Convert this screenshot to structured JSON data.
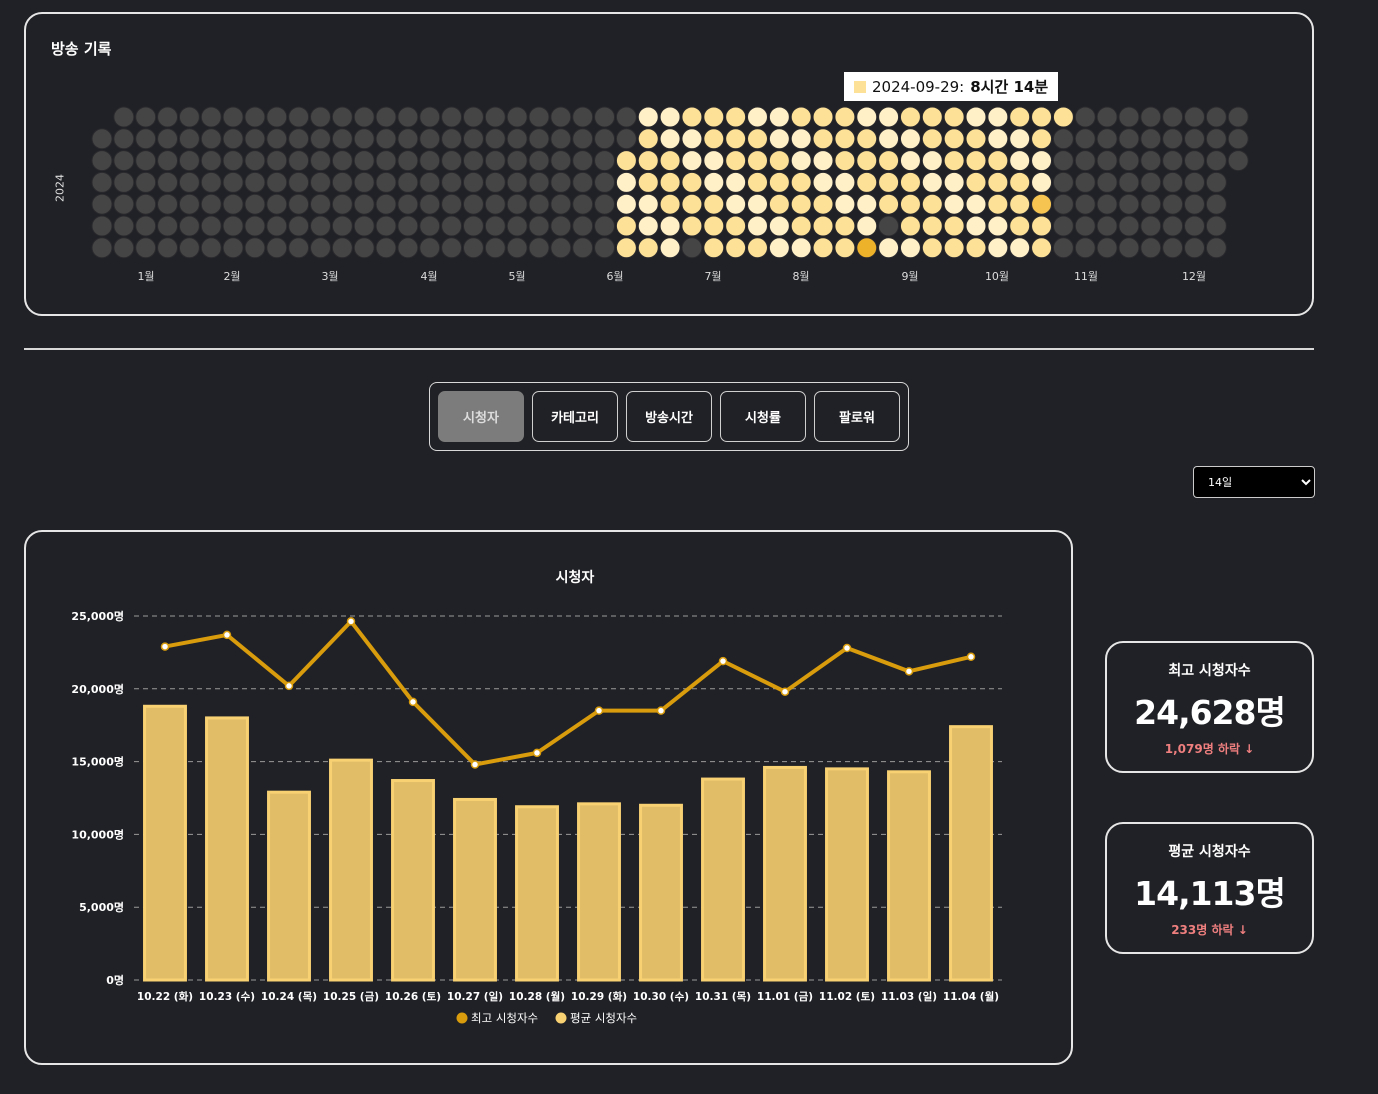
{
  "history": {
    "title": "방송 기록",
    "year": "2024",
    "months": [
      "1월",
      "2월",
      "3월",
      "4월",
      "5월",
      "6월",
      "7월",
      "8월",
      "9월",
      "10월",
      "11월",
      "12월"
    ],
    "tooltip": {
      "date": "2024-09-29:",
      "value": "8시간 14분"
    },
    "colors": {
      "empty": "#454545",
      "low": "#fff0c7",
      "mid": "#fde196",
      "high": "#f6c450",
      "peak": "#eeb12a"
    }
  },
  "tabs": [
    "시청자",
    "카테고리",
    "방송시간",
    "시청률",
    "팔로워"
  ],
  "active_tab": "시청자",
  "period_select": {
    "value": "14일"
  },
  "stats": {
    "max": {
      "label": "최고 시청자수",
      "value": "24,628명",
      "change": "1,079명 하락 ↓"
    },
    "avg": {
      "label": "평균 시청자수",
      "value": "14,113명",
      "change": "233명 하락 ↓"
    }
  },
  "chart_data": {
    "type": "bar",
    "title": "시청자",
    "categories": [
      "10.22 (화)",
      "10.23 (수)",
      "10.24 (목)",
      "10.25 (금)",
      "10.26 (토)",
      "10.27 (일)",
      "10.28 (월)",
      "10.29 (화)",
      "10.30 (수)",
      "10.31 (목)",
      "11.01 (금)",
      "11.02 (토)",
      "11.03 (일)",
      "11.04 (월)"
    ],
    "ylim": [
      0,
      25000
    ],
    "yticks": [
      "0명",
      "5,000명",
      "10,000명",
      "15,000명",
      "20,000명",
      "25,000명"
    ],
    "grid": true,
    "legend_position": "bottom",
    "series": [
      {
        "name": "최고 시청자수",
        "type": "line",
        "color": "#d89c0c",
        "values": [
          22900,
          23700,
          20200,
          24628,
          19100,
          14800,
          15600,
          18500,
          18500,
          21900,
          19800,
          22800,
          21200,
          22200
        ]
      },
      {
        "name": "평균 시청자수",
        "type": "bar",
        "color": "#f8d173",
        "values": [
          18800,
          18000,
          12900,
          15100,
          13700,
          12400,
          11900,
          12100,
          12000,
          13800,
          14600,
          14500,
          14300,
          17400
        ]
      }
    ]
  }
}
